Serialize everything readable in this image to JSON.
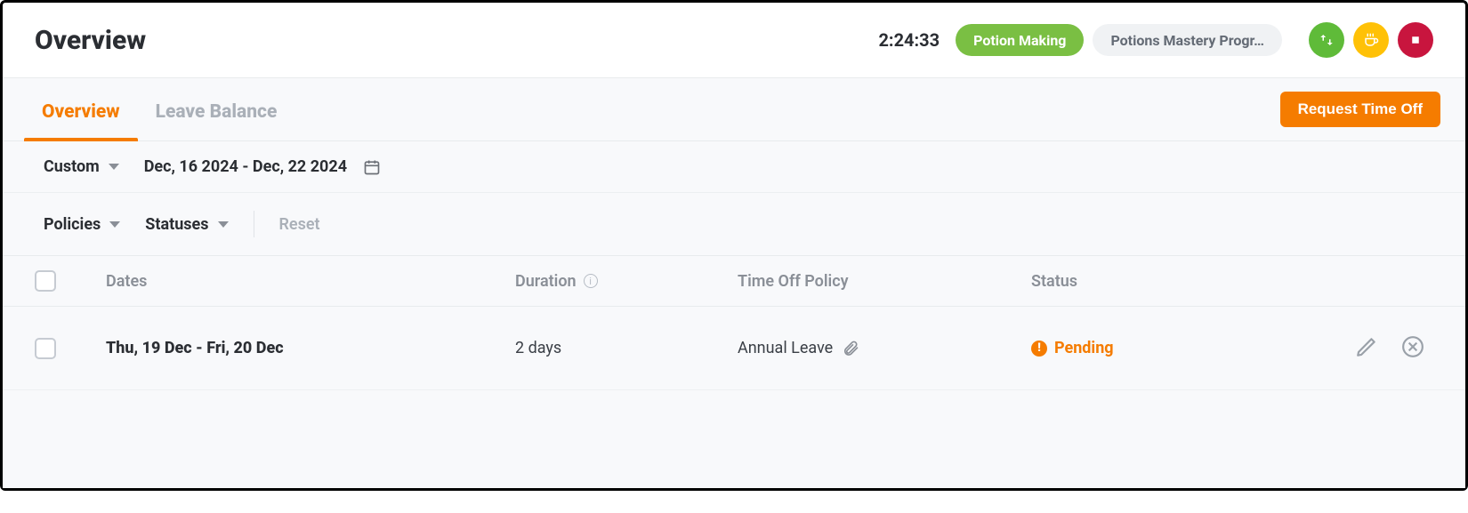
{
  "page_title": "Overview",
  "timer": "2:24:33",
  "pills": {
    "task": "Potion Making",
    "project": "Potions Mastery Progr…"
  },
  "tabs": {
    "overview": "Overview",
    "leave_balance": "Leave Balance"
  },
  "buttons": {
    "request_time_off": "Request Time Off"
  },
  "date_filter": {
    "mode": "Custom",
    "range": "Dec, 16 2024 - Dec, 22 2024"
  },
  "filters": {
    "policies": "Policies",
    "statuses": "Statuses",
    "reset": "Reset"
  },
  "table": {
    "headers": {
      "dates": "Dates",
      "duration": "Duration",
      "policy": "Time Off Policy",
      "status": "Status"
    },
    "rows": [
      {
        "dates": "Thu, 19 Dec - Fri, 20 Dec",
        "duration": "2 days",
        "policy": "Annual Leave",
        "status": "Pending"
      }
    ]
  }
}
